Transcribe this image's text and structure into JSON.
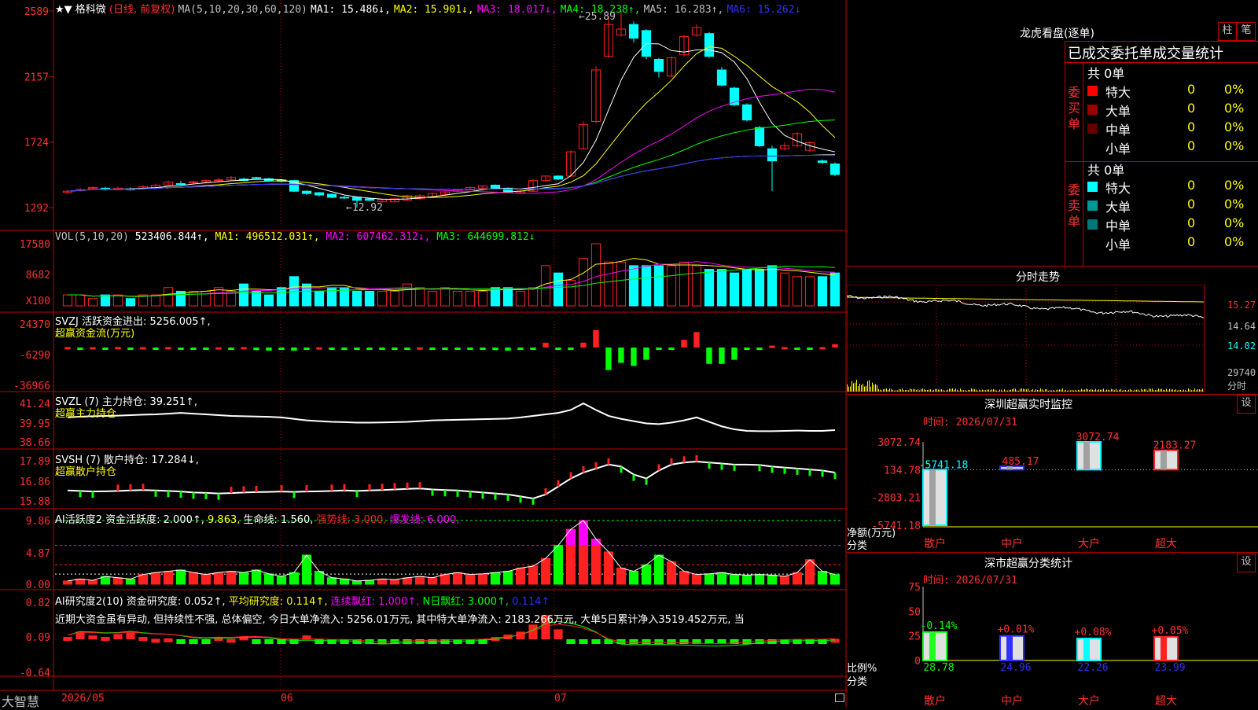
{
  "main": {
    "stock_title": "格科微",
    "period_note": "(日线, 前复权)",
    "ma_label": "MA(5,10,20,30,60,120)",
    "ma1": "MA1: 15.486↓,",
    "ma2": "MA2: 15.901↓,",
    "ma3": "MA3: 18.017↓,",
    "ma4": "MA4: 18.238↑,",
    "ma5": "MA5: 16.283↑,",
    "ma6": "MA6: 15.262↓",
    "high_note": "←25.89",
    "low_note": "←12.92",
    "axis": [
      "2589",
      "2157",
      "1724",
      "1292"
    ]
  },
  "vol": {
    "label": "VOL(5,10,20)",
    "value": "523406.844↑,",
    "ma1": "MA1: 496512.031↑,",
    "ma2": "MA2: 607462.312↓,",
    "ma3": "MA3: 644699.812↓",
    "axis": [
      "17580",
      "8682",
      "X100"
    ]
  },
  "svzj": {
    "label": "SVZJ  活跃资金进出: 5256.005↑,",
    "sub": "超赢资金流(万元)",
    "axis": [
      "24370",
      "-6290",
      "-36966"
    ]
  },
  "svzl": {
    "label": "SVZL (7) 主力持仓: 39.251↑,",
    "sub": "超赢主力持仓",
    "axis": [
      "41.24",
      "39.95",
      "38.66"
    ]
  },
  "svsh": {
    "label": "SVSH (7) 散户持仓: 17.284↓,",
    "sub": "超赢散户持仓",
    "axis": [
      "17.89",
      "16.86",
      "15.88"
    ]
  },
  "ai_act": {
    "label_a": "AI活跃度2 资金活跃度: 2.000↑,",
    "label_b": "9.863,",
    "label_c": "生命线: 1.560,",
    "label_d": "强势线: 3.000,",
    "label_e": "爆发线: 6.000,",
    "axis": [
      "9.86",
      "4.87",
      "0.00"
    ]
  },
  "ai_res": {
    "label_a": "AI研究度2(10) 资金研究度: 0.052↑,",
    "label_b": "平均研究度: 0.114↑,",
    "label_c": "连续飘红: 1.000↑,",
    "label_d": "N日飘红: 3.000↑,",
    "label_e": "0.114↑",
    "note": "近期大资金虽有异动, 但持续性不强, 总体偏空, 今日大单净流入: 5256.01万元, 其中特大单净流入: 2183.266万元, 大单5日累计净入3519.452万元, 当",
    "axis": [
      "0.82",
      "0.09",
      "-0.64"
    ]
  },
  "bottom": {
    "brand": "大智慧",
    "dates": [
      "2026/05",
      "06",
      "07"
    ]
  },
  "panel_lhb": {
    "title": "龙虎看盘(逐单)",
    "btn1": "柱",
    "btn2": "笔",
    "header": "已成交委托单成交量统计",
    "buy_label": "委买单",
    "sell_label": "委卖单",
    "buy_total": "共 0单",
    "sell_total": "共 0单",
    "buy_rows": [
      {
        "name": "特大",
        "count": "0",
        "pct": "0%",
        "color": "#ff0000"
      },
      {
        "name": "大单",
        "count": "0",
        "pct": "0%",
        "color": "#990000"
      },
      {
        "name": "中单",
        "count": "0",
        "pct": "0%",
        "color": "#660000"
      },
      {
        "name": "小单",
        "count": "0",
        "pct": "0%",
        "color": "#000000"
      }
    ],
    "sell_rows": [
      {
        "name": "特大",
        "count": "0",
        "pct": "0%",
        "color": "#00ffff"
      },
      {
        "name": "大单",
        "count": "0",
        "pct": "0%",
        "color": "#009999"
      },
      {
        "name": "中单",
        "count": "0",
        "pct": "0%",
        "color": "#007777"
      },
      {
        "name": "小单",
        "count": "0",
        "pct": "0%",
        "color": "#000000"
      }
    ]
  },
  "panel_fenshi": {
    "title": "分时走势",
    "axis": [
      "15.27",
      "14.64",
      "14.02",
      "29740",
      "分时"
    ]
  },
  "panel_sz": {
    "title": "深圳超赢实时监控",
    "btn": "设",
    "time": "时间: 2026/07/31",
    "axis": [
      "3072.74",
      "134.78",
      "-2803.21",
      "-5741.18"
    ],
    "axis_label_a": "净额(万元)",
    "axis_label_b": "分类",
    "bars": [
      {
        "cat": "散户",
        "label": "-5741.18",
        "value": -5741.18,
        "color": "#00ffff"
      },
      {
        "cat": "中户",
        "label": "485.17",
        "value": 485.17,
        "color": "#3030ff"
      },
      {
        "cat": "大户",
        "label": "3072.74",
        "value": 3072.74,
        "color": "#00ffff"
      },
      {
        "cat": "超大",
        "label": "2183.27",
        "value": 2183.27,
        "color": "#ff2020"
      }
    ]
  },
  "panel_ss": {
    "title": "深市超赢分类统计",
    "btn": "设",
    "time": "时间: 2026/07/31",
    "axis": [
      "75",
      "50",
      "25",
      "0"
    ],
    "axis_label_a": "比例%",
    "axis_label_b": "分类",
    "bars": [
      {
        "cat": "散户",
        "top": "-0.14%",
        "value": 28.78,
        "label": "28.78",
        "color": "#20ff20"
      },
      {
        "cat": "中户",
        "top": "+0.01%",
        "value": 24.96,
        "label": "24.96",
        "color": "#3030ff"
      },
      {
        "cat": "大户",
        "top": "+0.08%",
        "value": 22.26,
        "label": "22.26",
        "color": "#00ffff"
      },
      {
        "cat": "超大",
        "top": "+0.05%",
        "value": 23.99,
        "label": "23.99",
        "color": "#ff2020"
      }
    ]
  },
  "colors": {
    "up": "#ff2020",
    "down": "#00ffff",
    "grid": "#c00000",
    "text_yellow": "#ffff00",
    "text_magenta": "#ff00ff"
  },
  "chart_data": {
    "type": "candlestick",
    "x": [
      "D1",
      "D2",
      "D3",
      "D4",
      "D5",
      "D6",
      "D7",
      "D8",
      "D9",
      "D10",
      "D11",
      "D12",
      "D13",
      "D14",
      "D15",
      "D16",
      "D17",
      "D18",
      "D19",
      "D20",
      "D21",
      "D22",
      "D23",
      "D24",
      "D25",
      "D26",
      "D27",
      "D28",
      "D29",
      "D30",
      "D31",
      "D32",
      "D33",
      "D34",
      "D35",
      "D36",
      "D37",
      "D38",
      "D39",
      "D40",
      "D41",
      "D42",
      "D43",
      "D44",
      "D45",
      "D46",
      "D47",
      "D48",
      "D49",
      "D50",
      "D51",
      "D52",
      "D53",
      "D54",
      "D55",
      "D56",
      "D57",
      "D58",
      "D59",
      "D60",
      "D61",
      "D62"
    ],
    "open": [
      1392,
      1405,
      1418,
      1420,
      1410,
      1415,
      1420,
      1425,
      1440,
      1450,
      1458,
      1462,
      1470,
      1475,
      1480,
      1490,
      1482,
      1475,
      1470,
      1400,
      1390,
      1380,
      1360,
      1360,
      1350,
      1330,
      1330,
      1340,
      1350,
      1360,
      1380,
      1400,
      1410,
      1420,
      1440,
      1420,
      1390,
      1400,
      1470,
      1500,
      1500,
      1680,
      1860,
      2290,
      2430,
      2500,
      2460,
      2270,
      2160,
      2300,
      2430,
      2440,
      2200,
      2080,
      1970,
      1820,
      1680,
      1680,
      1700,
      1670,
      1600,
      1580
    ],
    "close": [
      1400,
      1410,
      1425,
      1415,
      1420,
      1410,
      1430,
      1440,
      1460,
      1445,
      1462,
      1470,
      1475,
      1490,
      1470,
      1485,
      1470,
      1465,
      1400,
      1385,
      1375,
      1360,
      1355,
      1340,
      1340,
      1345,
      1350,
      1370,
      1370,
      1385,
      1395,
      1410,
      1425,
      1435,
      1420,
      1395,
      1400,
      1470,
      1500,
      1480,
      1660,
      1840,
      2200,
      2500,
      2470,
      2410,
      2290,
      2190,
      2280,
      2420,
      2480,
      2290,
      2100,
      1970,
      1870,
      1700,
      1600,
      1700,
      1780,
      1720,
      1590,
      1510
    ],
    "high": [
      1410,
      1420,
      1432,
      1428,
      1430,
      1425,
      1440,
      1450,
      1470,
      1470,
      1470,
      1478,
      1485,
      1500,
      1490,
      1495,
      1488,
      1480,
      1475,
      1405,
      1395,
      1385,
      1370,
      1365,
      1355,
      1350,
      1358,
      1378,
      1380,
      1392,
      1400,
      1415,
      1430,
      1440,
      1445,
      1425,
      1410,
      1478,
      1505,
      1505,
      1670,
      1860,
      2225,
      2560,
      2589,
      2520,
      2470,
      2280,
      2290,
      2430,
      2500,
      2450,
      2220,
      2090,
      1980,
      1830,
      1700,
      1720,
      1790,
      1730,
      1610,
      1590
    ],
    "low": [
      1385,
      1398,
      1410,
      1405,
      1405,
      1405,
      1415,
      1420,
      1435,
      1440,
      1450,
      1455,
      1465,
      1470,
      1465,
      1478,
      1465,
      1458,
      1395,
      1375,
      1365,
      1355,
      1350,
      1292,
      1335,
      1325,
      1326,
      1338,
      1345,
      1355,
      1372,
      1395,
      1405,
      1415,
      1418,
      1390,
      1385,
      1395,
      1465,
      1475,
      1495,
      1675,
      1850,
      2280,
      2420,
      2380,
      2270,
      2150,
      2150,
      2290,
      2420,
      2280,
      2090,
      1960,
      1860,
      1690,
      1400,
      1670,
      1690,
      1660,
      1580,
      1500
    ],
    "volume": [
      3,
      3,
      2,
      3,
      3,
      2,
      3,
      3,
      5,
      4,
      4,
      4,
      5,
      4,
      6,
      4,
      3,
      5,
      8,
      6,
      4,
      5,
      5,
      4,
      4,
      4,
      4,
      6,
      5,
      4,
      5,
      4,
      4,
      4,
      5,
      5,
      4,
      5,
      11,
      9,
      7,
      13,
      17,
      12,
      12,
      11,
      11,
      11,
      11,
      12,
      11,
      10,
      10,
      9,
      10,
      10,
      11,
      9,
      8,
      8,
      8,
      9
    ],
    "svzj": [
      500,
      -300,
      400,
      -200,
      600,
      -300,
      400,
      -400,
      500,
      -2000,
      -300,
      -400,
      300,
      -300,
      500,
      -2500,
      -3000,
      -2000,
      -3000,
      -2000,
      300,
      -400,
      -600,
      -300,
      -500,
      -400,
      -600,
      -500,
      200,
      -300,
      -2000,
      -800,
      -300,
      -500,
      -2500,
      -3000,
      -300,
      -2000,
      5000,
      -800,
      -1200,
      5000,
      18000,
      -22000,
      -15000,
      -18000,
      -12000,
      -500,
      -300,
      8000,
      16000,
      -16000,
      -16000,
      -12000,
      -500,
      -300,
      2000,
      500,
      -800,
      -400,
      500,
      3500
    ],
    "svzl": [
      40.3,
      40.35,
      40.38,
      40.4,
      40.42,
      40.45,
      40.48,
      40.5,
      40.55,
      40.6,
      40.55,
      40.5,
      40.45,
      40.4,
      40.38,
      40.36,
      40.34,
      40.3,
      40.2,
      40.1,
      40.05,
      40.0,
      39.98,
      39.95,
      39.95,
      39.96,
      39.98,
      40.0,
      40.05,
      40.1,
      40.12,
      40.14,
      40.16,
      40.18,
      40.2,
      40.22,
      40.3,
      40.4,
      40.5,
      40.6,
      40.8,
      41.24,
      40.8,
      40.4,
      40.2,
      40.05,
      39.9,
      39.85,
      39.95,
      40.1,
      40.3,
      40.0,
      39.7,
      39.5,
      39.4,
      39.38,
      39.38,
      39.4,
      39.42,
      39.4,
      39.4,
      39.45
    ],
    "svsh": [
      16.4,
      16.38,
      16.35,
      16.36,
      16.38,
      16.4,
      16.42,
      16.4,
      16.38,
      16.35,
      16.3,
      16.28,
      16.25,
      16.27,
      16.3,
      16.32,
      16.33,
      16.35,
      16.33,
      16.35,
      16.36,
      16.38,
      16.4,
      16.38,
      16.4,
      16.42,
      16.45,
      16.48,
      16.5,
      16.45,
      16.42,
      16.4,
      16.35,
      16.3,
      16.25,
      16.2,
      16.1,
      16.0,
      16.2,
      16.6,
      17.0,
      17.3,
      17.5,
      17.7,
      17.6,
      17.2,
      17.0,
      17.4,
      17.7,
      17.8,
      17.85,
      17.8,
      17.75,
      17.7,
      17.7,
      17.68,
      17.6,
      17.55,
      17.5,
      17.45,
      17.4,
      17.3
    ],
    "ai_act": [
      0.5,
      0.8,
      0.6,
      1.2,
      1.0,
      0.8,
      1.5,
      1.8,
      2.0,
      2.2,
      1.8,
      1.5,
      1.8,
      2.0,
      1.8,
      2.2,
      1.6,
      1.2,
      1.8,
      4.5,
      2.0,
      1.0,
      0.8,
      0.5,
      0.6,
      0.8,
      0.7,
      1.0,
      1.2,
      1.0,
      1.5,
      1.8,
      1.5,
      1.6,
      1.8,
      2.0,
      2.5,
      2.8,
      4.0,
      6.0,
      8.5,
      9.86,
      7.0,
      5.0,
      2.5,
      2.0,
      3.0,
      4.5,
      3.5,
      2.0,
      1.5,
      1.6,
      1.8,
      1.5,
      1.4,
      1.5,
      1.4,
      1.2,
      1.8,
      3.8,
      2.0,
      1.5
    ],
    "ai_res": [
      0.09,
      0.2,
      0.12,
      0.09,
      0.15,
      0.18,
      0.09,
      0.05,
      0.06,
      0.04,
      0.02,
      0.04,
      0.09,
      0.05,
      0.1,
      0.03,
      -0.02,
      -0.05,
      0.0,
      0.12,
      0.02,
      -0.06,
      -0.05,
      -0.03,
      -0.04,
      -0.02,
      -0.03,
      0.02,
      0.0,
      -0.01,
      0.0,
      0.01,
      0.02,
      0.04,
      0.09,
      0.14,
      0.2,
      0.35,
      0.55,
      0.25,
      0.0,
      -0.05,
      -0.06,
      -0.05,
      -0.05,
      -0.04,
      -0.04,
      -0.05,
      -0.07,
      -0.08,
      -0.08,
      -0.07,
      -0.05,
      -0.02,
      0.0,
      0.02,
      0.0,
      0.02,
      0.0,
      0.01,
      0.02,
      0.05
    ],
    "ylim": [
      1292,
      2589
    ]
  }
}
